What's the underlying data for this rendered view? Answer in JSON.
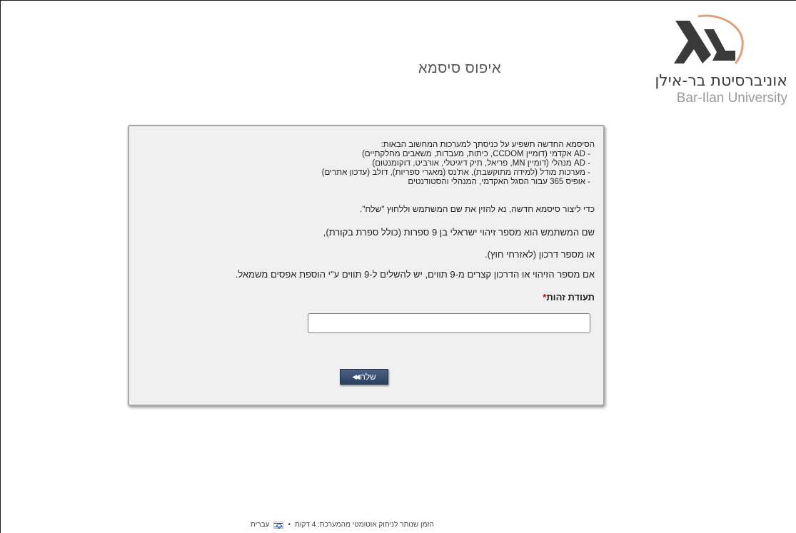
{
  "logo": {
    "name_he": "אוניברסיטת בר-אילן",
    "name_en": "Bar-Ilan University",
    "colors": {
      "mark_dark": "#3a3a3a",
      "mark_accent": "#e0a07a"
    }
  },
  "page": {
    "title": "איפוס סיסמא"
  },
  "info": {
    "intro": "הסיסמא החדשה תשפיע על כניסתך למערכות המחשוב הבאות:",
    "systems": [
      "- AD אקדמי (דומיין CCDOM, כיתות, מעבדות, משאבים מחלקתיים)",
      "- AD מנהלי (דומיין MN, פריאל, תיק דיגיטלי, אורביט, דוקומנטום)",
      "- מערכות מודל (למידה מתוקשבת), את'נס (מאגרי ספריות), דולב (עדכון אתרים)",
      "- אופיס 365 עבור הסגל האקדמי, המנהלי והסטודנטים"
    ],
    "create_instruction": "כדי ליצור סיסמא חדשה, נא להזין את שם המשתמש וללחוץ \"שלח\".",
    "username_rule": "שם המשתמש הוא מספר זיהוי ישראלי בן 9 ספרות (כולל ספרת בקורת),",
    "passport_rule": "או מספר דרכון (לאזרחי חוץ).",
    "padding_rule": "אם מספר הזיהוי או הדרכון קצרים מ-9 תווים, יש להשלים ל-9 תווים ע\"י הוספת אפסים משמאל."
  },
  "form": {
    "id_label": "תעודת זהות",
    "required_mark": "*",
    "id_value": "",
    "send_label": "שלח",
    "send_icon": "double-arrow-icon"
  },
  "footer": {
    "timeout_text": "הזמן שנותר לניתוק אוטומטי מהמערכת: 4 דקות",
    "separator": "•",
    "language_label": "עברית",
    "language_icon": "israel-flag-icon"
  }
}
